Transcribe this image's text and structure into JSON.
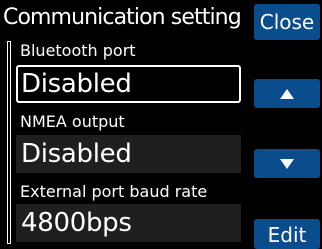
{
  "header": {
    "title": "Communication setting",
    "close_label": "Close"
  },
  "settings": [
    {
      "label": "Bluetooth port",
      "value": "Disabled"
    },
    {
      "label": "NMEA output",
      "value": "Disabled"
    },
    {
      "label": "External port baud rate",
      "value": "4800bps"
    }
  ],
  "controls": {
    "up_icon": "arrow-up-icon",
    "down_icon": "arrow-down-icon",
    "edit_label": "Edit"
  },
  "colors": {
    "background": "#000000",
    "button": "#0a4d8c",
    "value_field": "#1f1f1f",
    "text": "#ffffff"
  }
}
